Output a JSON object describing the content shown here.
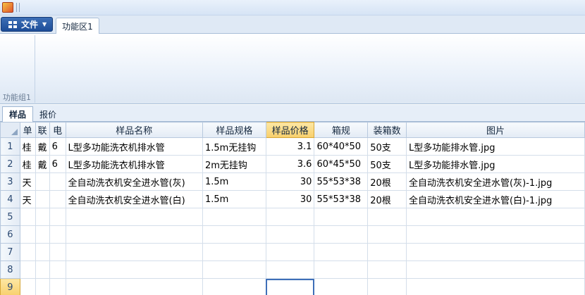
{
  "ribbon": {
    "file_label": "文件",
    "tab_label": "功能区1",
    "group_label": "功能组1"
  },
  "sheet_tabs": [
    "样品",
    "报价"
  ],
  "grid": {
    "columns": [
      "单",
      "联",
      "电",
      "样品名称",
      "样品规格",
      "样品价格",
      "箱规",
      "装箱数",
      "图片"
    ],
    "rows": [
      {
        "num": "1",
        "cells": [
          "桂",
          "戴",
          "6",
          "L型多功能洗衣机排水管",
          "1.5m无挂钩",
          "3.1",
          "60*40*50",
          "50支",
          "L型多功能排水管.jpg"
        ]
      },
      {
        "num": "2",
        "cells": [
          "桂",
          "戴",
          "6",
          "L型多功能洗衣机排水管",
          "2m无挂钩",
          "3.6",
          "60*45*50",
          "50支",
          "L型多功能排水管.jpg"
        ]
      },
      {
        "num": "3",
        "cells": [
          "天",
          "",
          "",
          "全自动洗衣机安全进水管(灰)",
          "1.5m",
          "30",
          "55*53*38",
          "20根",
          "全自动洗衣机安全进水管(灰)-1.jpg"
        ]
      },
      {
        "num": "4",
        "cells": [
          "天",
          "",
          "",
          "全自动洗衣机安全进水管(白)",
          "1.5m",
          "30",
          "55*53*38",
          "20根",
          "全自动洗衣机安全进水管(白)-1.jpg"
        ]
      },
      {
        "num": "5",
        "cells": [
          "",
          "",
          "",
          "",
          "",
          "",
          "",
          "",
          ""
        ]
      },
      {
        "num": "6",
        "cells": [
          "",
          "",
          "",
          "",
          "",
          "",
          "",
          "",
          ""
        ]
      },
      {
        "num": "7",
        "cells": [
          "",
          "",
          "",
          "",
          "",
          "",
          "",
          "",
          ""
        ]
      },
      {
        "num": "8",
        "cells": [
          "",
          "",
          "",
          "",
          "",
          "",
          "",
          "",
          ""
        ]
      },
      {
        "num": "9",
        "cells": [
          "",
          "",
          "",
          "",
          "",
          "",
          "",
          "",
          ""
        ]
      }
    ]
  },
  "colors": {
    "selection_header": "#f8cf6c",
    "active_cell_border": "#3e6fb8",
    "file_button": "#1d4d98"
  }
}
